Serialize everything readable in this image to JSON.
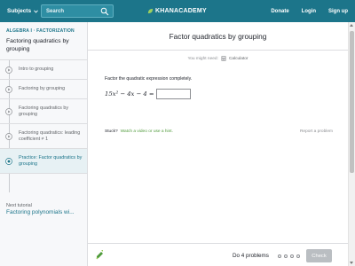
{
  "nav": {
    "subjects_label": "Subjects",
    "search_placeholder": "Search",
    "logo_text": "KHANACADEMY",
    "donate_label": "Donate",
    "login_label": "Login",
    "signup_label": "Sign up",
    "brand_color": "#1c758a"
  },
  "sidebar": {
    "breadcrumb": "ALGEBRA I · FACTORIZATION",
    "topic_title": "Factoring quadratics by grouping",
    "items": [
      {
        "label": "Intro to grouping",
        "icon": "video-icon",
        "active": false
      },
      {
        "label": "Factoring by grouping",
        "icon": "video-icon",
        "active": false
      },
      {
        "label": "Factoring quadratics by grouping",
        "icon": "video-icon",
        "active": false
      },
      {
        "label": "Factoring quadratics: leading coefficient ≠ 1",
        "icon": "video-icon",
        "active": false
      },
      {
        "label": "Practice: Factor quadratics by grouping",
        "icon": "practice-icon",
        "active": true
      }
    ],
    "next_label": "Next tutorial",
    "next_link": "Factoring polynomials wi..."
  },
  "main": {
    "title": "Factor quadratics by grouping",
    "might_need": "You might need:",
    "calculator_label": "Calculator",
    "prompt": "Factor the quadratic expression completely.",
    "expression": "15x² − 4x − 4 =",
    "answer_value": "",
    "stuck_label": "Stuck?",
    "hint_link": "Watch a video or use a hint.",
    "report_label": "Report a problem"
  },
  "footer": {
    "do_label": "Do 4 problems",
    "check_label": "Check",
    "problem_count": 4
  }
}
